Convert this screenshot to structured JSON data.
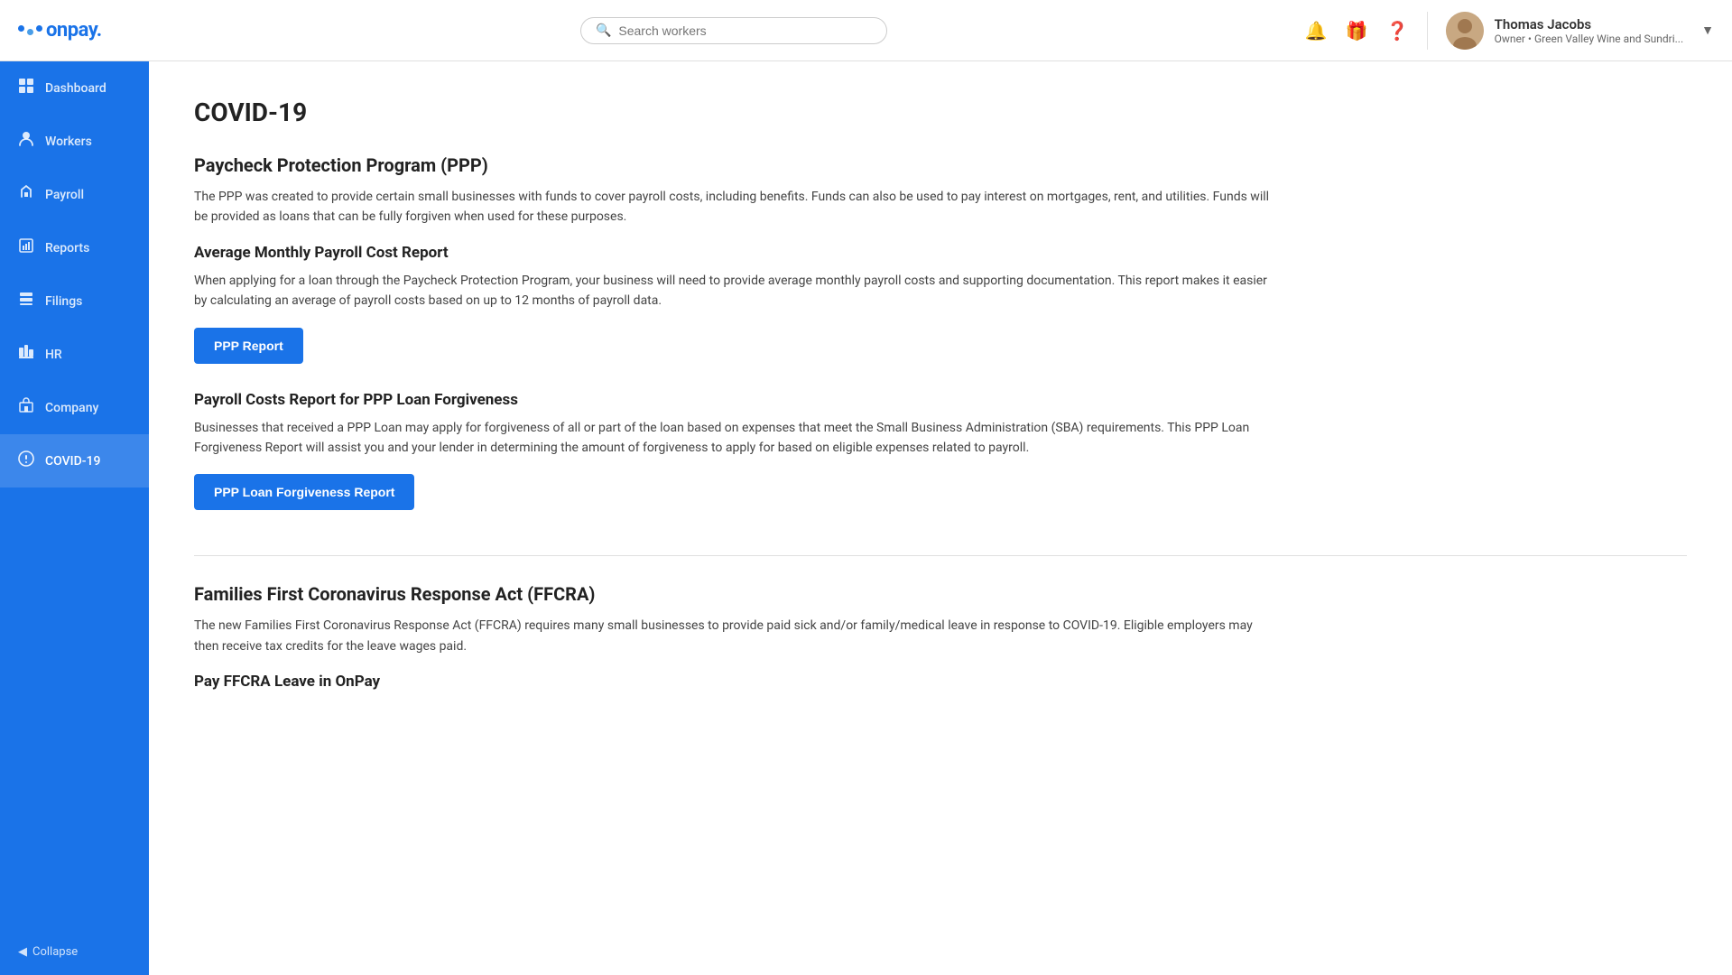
{
  "header": {
    "logo_text": "onpay.",
    "search_placeholder": "Search workers",
    "user": {
      "name": "Thomas Jacobs",
      "role": "Owner • Green Valley Wine and Sundri..."
    }
  },
  "sidebar": {
    "items": [
      {
        "id": "dashboard",
        "label": "Dashboard",
        "icon": "⊞"
      },
      {
        "id": "workers",
        "label": "Workers",
        "icon": "👤"
      },
      {
        "id": "payroll",
        "label": "Payroll",
        "icon": "✋"
      },
      {
        "id": "reports",
        "label": "Reports",
        "icon": "📊"
      },
      {
        "id": "filings",
        "label": "Filings",
        "icon": "🗂"
      },
      {
        "id": "hr",
        "label": "HR",
        "icon": "🏢"
      },
      {
        "id": "company",
        "label": "Company",
        "icon": "🏪"
      },
      {
        "id": "covid19",
        "label": "COVID-19",
        "icon": "ℹ",
        "active": true
      }
    ],
    "collapse_label": "◀ Collapse"
  },
  "content": {
    "page_title": "COVID-19",
    "sections": [
      {
        "id": "ppp",
        "title": "Paycheck Protection Program (PPP)",
        "description": "The PPP was created to provide certain small businesses with funds to cover payroll costs, including benefits. Funds can also be used to pay interest on mortgages, rent, and utilities. Funds will be provided as loans that can be fully forgiven when used for these purposes.",
        "subsections": [
          {
            "id": "avg-monthly",
            "title": "Average Monthly Payroll Cost Report",
            "description": "When applying for a loan through the Paycheck Protection Program, your business will need to provide average monthly payroll costs and supporting documentation. This report makes it easier by calculating an average of payroll costs based on up to 12 months of payroll data.",
            "button_label": "PPP Report"
          },
          {
            "id": "loan-forgiveness",
            "title": "Payroll Costs Report for PPP Loan Forgiveness",
            "description": "Businesses that received a PPP Loan may apply for forgiveness of all or part of the loan based on expenses that meet the Small Business Administration (SBA) requirements. This PPP Loan Forgiveness Report will assist you and your lender in determining the amount of forgiveness to apply for based on eligible expenses related to payroll.",
            "button_label": "PPP Loan Forgiveness Report"
          }
        ]
      },
      {
        "id": "ffcra",
        "title": "Families First Coronavirus Response Act (FFCRA)",
        "description": "The new Families First Coronavirus Response Act (FFCRA) requires many small businesses to provide paid sick and/or family/medical leave in response to COVID-19. Eligible employers may then receive tax credits for the leave wages paid.",
        "subsections": [
          {
            "id": "pay-ffcra",
            "title": "Pay FFCRA Leave in OnPay",
            "description": "",
            "button_label": ""
          }
        ]
      }
    ]
  }
}
